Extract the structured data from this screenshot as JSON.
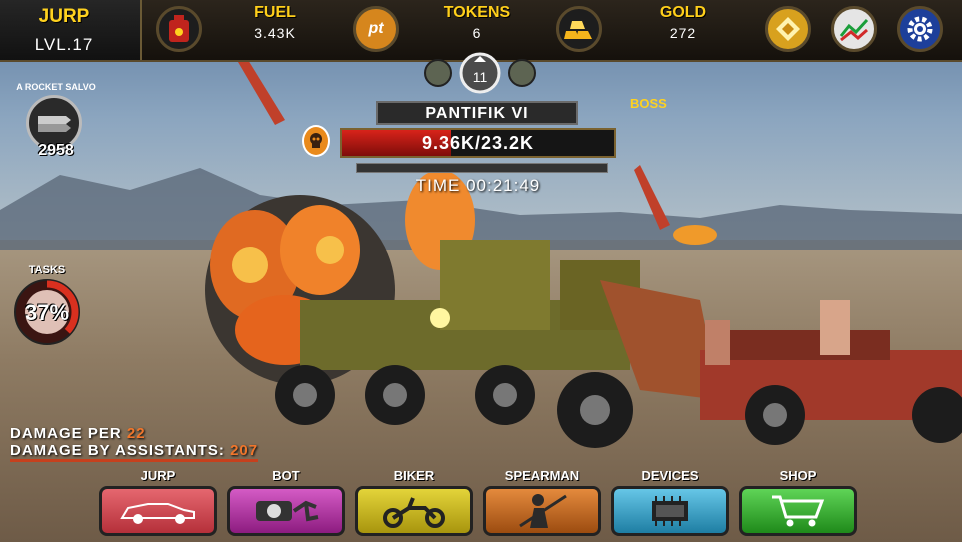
{
  "player": {
    "name": "JURP",
    "level": "LVL.17"
  },
  "resources": {
    "fuel": {
      "label": "FUEL",
      "value": "3.43K"
    },
    "tokens": {
      "label": "TOKENS",
      "value": "6"
    },
    "gold": {
      "label": "GOLD",
      "value": "272"
    }
  },
  "top_icons": [
    "fuel-can-icon",
    "pt-token-icon",
    "gold-bars-icon",
    "achievement-icon",
    "stats-chart-icon",
    "settings-gear-icon"
  ],
  "wave": {
    "current": "11"
  },
  "skill": {
    "name": "A ROCKET SALVO",
    "count": "2958"
  },
  "boss": {
    "name": "PANTIFIK VI",
    "hp": "9.36K/23.2K",
    "hp_fraction": 0.4,
    "tag": "BOSS"
  },
  "timer": "TIME 00:21:49",
  "tasks": {
    "label": "TASKS",
    "percent": "37%",
    "fraction": 0.37
  },
  "damage": {
    "per_label": "DAMAGE PER",
    "per_value": "22",
    "assist_label": "DAMAGE BY ASSISTANTS:",
    "assist_value": "207"
  },
  "tabs": [
    {
      "label": "JURP",
      "icon": "car-icon",
      "color": "#d8434f"
    },
    {
      "label": "BOT",
      "icon": "robot-arm-icon",
      "color": "#b0329f"
    },
    {
      "label": "BIKER",
      "icon": "motorbike-icon",
      "color": "#c8b420"
    },
    {
      "label": "SPEARMAN",
      "icon": "spearman-icon",
      "color": "#c06a23"
    },
    {
      "label": "DEVICES",
      "icon": "chip-icon",
      "color": "#2fa7cf"
    },
    {
      "label": "SHOP",
      "icon": "cart-icon",
      "color": "#35b62d"
    }
  ],
  "colors": {
    "accent": "#ffd21f",
    "hp": "#d8231a",
    "damage_value": "#f0762c"
  }
}
